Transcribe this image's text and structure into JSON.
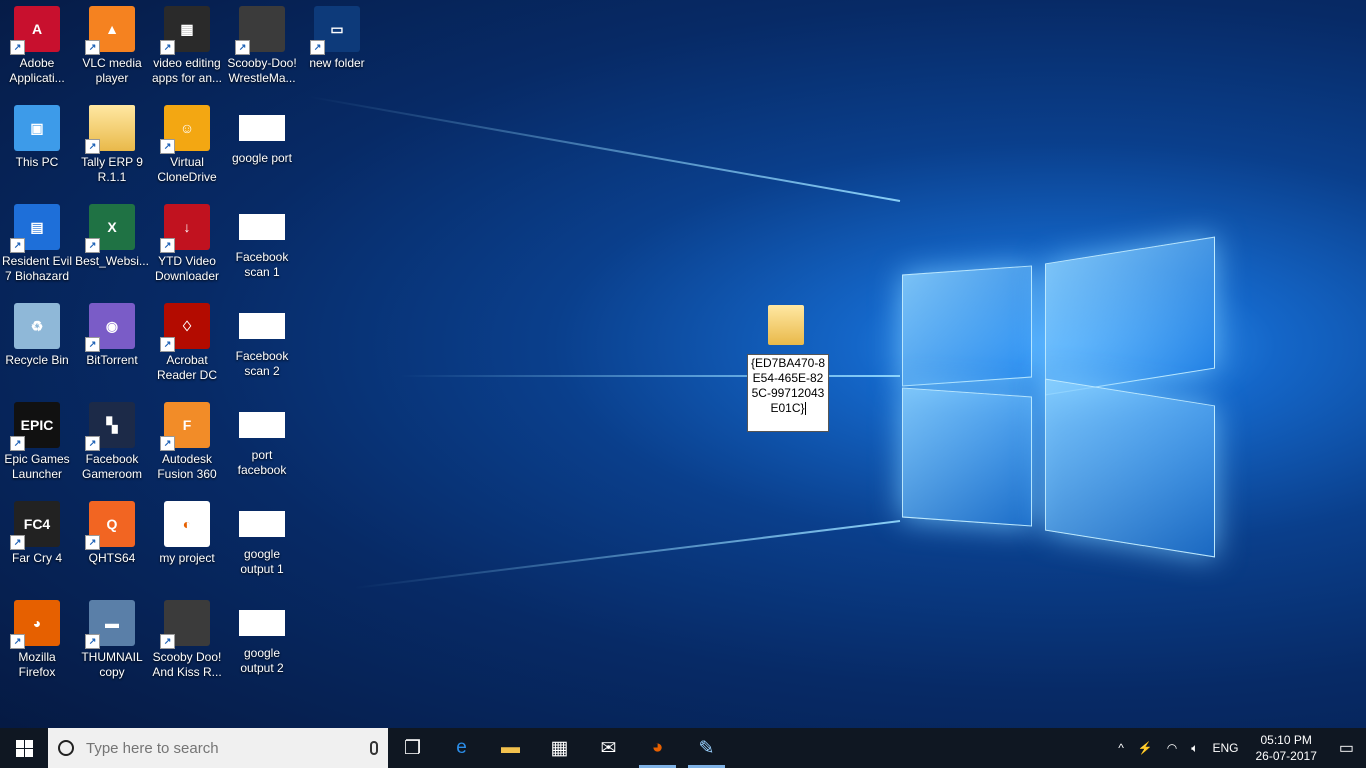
{
  "desktop_icons": [
    {
      "label": "Adobe\nApplicati...",
      "glyph": "A",
      "bg": "#c8102e"
    },
    {
      "label": "VLC media\nplayer",
      "glyph": "▲",
      "bg": "#f58220"
    },
    {
      "label": "video editing\napps for an...",
      "glyph": "▦",
      "bg": "#2a2a2a"
    },
    {
      "label": "Scooby-Doo!\nWrestleMa...",
      "glyph": "",
      "bg": "#3b3b3b"
    },
    {
      "label": "new folder",
      "glyph": "▭",
      "bg": "#0d3a7a"
    },
    {
      "label": "This PC",
      "glyph": "▣",
      "bg": "#3d9be9"
    },
    {
      "label": "Tally ERP 9\nR.1.1",
      "glyph": "",
      "bg": "#e9c46a"
    },
    {
      "label": "Virtual\nCloneDrive",
      "glyph": "☺",
      "bg": "#f3a712"
    },
    {
      "label": "google port",
      "glyph": "",
      "bg": "#ffffff"
    },
    {
      "label": "Resident Evil\n7 Biohazard",
      "glyph": "▤",
      "bg": "#1e6fd9"
    },
    {
      "label": "Best_Websi...",
      "glyph": "X",
      "bg": "#1f7244"
    },
    {
      "label": "YTD Video\nDownloader",
      "glyph": "↓",
      "bg": "#c1121f"
    },
    {
      "label": "Facebook\nscan 1",
      "glyph": "",
      "bg": "#ffffff"
    },
    {
      "label": "Recycle Bin",
      "glyph": "♻",
      "bg": "#8fb8d8"
    },
    {
      "label": "BitTorrent",
      "glyph": "◉",
      "bg": "#7a5cc7"
    },
    {
      "label": "Acrobat\nReader DC",
      "glyph": "♢",
      "bg": "#b30b00"
    },
    {
      "label": "Facebook\nscan 2",
      "glyph": "",
      "bg": "#ffffff"
    },
    {
      "label": "Epic Games\nLauncher",
      "glyph": "EPIC",
      "bg": "#111111"
    },
    {
      "label": "Facebook\nGameroom",
      "glyph": "▚",
      "bg": "#1c2a48"
    },
    {
      "label": "Autodesk\nFusion 360",
      "glyph": "F",
      "bg": "#f28c28"
    },
    {
      "label": "port\nfacebook",
      "glyph": "",
      "bg": "#ffffff"
    },
    {
      "label": "Far Cry 4",
      "glyph": "FC4",
      "bg": "#222222"
    },
    {
      "label": "QHTS64",
      "glyph": "Q",
      "bg": "#f26522"
    },
    {
      "label": "my project",
      "glyph": "◐",
      "bg": "#ffffff"
    },
    {
      "label": "google\noutput 1",
      "glyph": "",
      "bg": "#ffffff"
    },
    {
      "label": "Mozilla\nFirefox",
      "glyph": "◕",
      "bg": "#e66000"
    },
    {
      "label": "THUMNAIL\ncopy",
      "glyph": "▬",
      "bg": "#5a7fa8"
    },
    {
      "label": "Scooby Doo!\nAnd Kiss R...",
      "glyph": "",
      "bg": "#3b3b3b"
    },
    {
      "label": "google\noutput 2",
      "glyph": "",
      "bg": "#ffffff"
    }
  ],
  "rename": {
    "text": "{ED7BA470-8E54-465E-825C-99712043E01C}"
  },
  "taskbar": {
    "search_placeholder": "Type here to search",
    "apps": [
      {
        "name": "task-view-icon",
        "glyph": "❐"
      },
      {
        "name": "edge-icon",
        "glyph": "e"
      },
      {
        "name": "file-explorer-icon",
        "glyph": "▬"
      },
      {
        "name": "store-icon",
        "glyph": "▦"
      },
      {
        "name": "mail-icon",
        "glyph": "✉"
      },
      {
        "name": "firefox-icon",
        "glyph": "◕"
      },
      {
        "name": "paint-icon",
        "glyph": "✎"
      }
    ],
    "tray": {
      "chevron": "^",
      "language": "ENG",
      "time": "05:10 PM",
      "date": "26-07-2017"
    }
  }
}
